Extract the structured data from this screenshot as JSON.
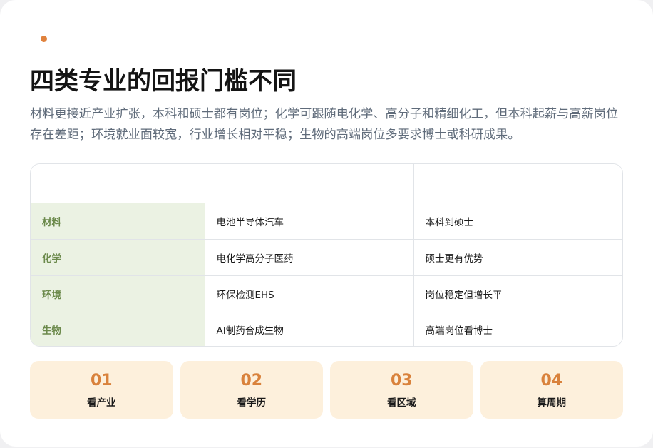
{
  "header": {
    "title": "四类专业的回报门槛不同",
    "description": "材料更接近产业扩张，本科和硕士都有岗位；化学可跟随电化学、高分子和精细化工，但本科起薪与高薪岗位存在差距；环境就业面较宽，行业增长相对平稳；生物的高端岗位多要求博士或科研成果。"
  },
  "colors": {
    "accent": "#e0823d",
    "row_head_bg": "#ebf2e3",
    "row_head_text": "#6c8a4c",
    "step_bg": "#fdf0dc",
    "step_num": "#d9823c"
  },
  "table": {
    "headers": [
      "",
      "",
      ""
    ],
    "rows": [
      {
        "major": "材料",
        "direction": "电池半导体汽车",
        "threshold": "本科到硕士"
      },
      {
        "major": "化学",
        "direction": "电化学高分子医药",
        "threshold": "硕士更有优势"
      },
      {
        "major": "环境",
        "direction": "环保检测EHS",
        "threshold": "岗位稳定但增长平"
      },
      {
        "major": "生物",
        "direction": "AI制药合成生物",
        "threshold": "高端岗位看博士"
      }
    ]
  },
  "steps": [
    {
      "num": "01",
      "label": "看产业"
    },
    {
      "num": "02",
      "label": "看学历"
    },
    {
      "num": "03",
      "label": "看区域"
    },
    {
      "num": "04",
      "label": "算周期"
    }
  ]
}
